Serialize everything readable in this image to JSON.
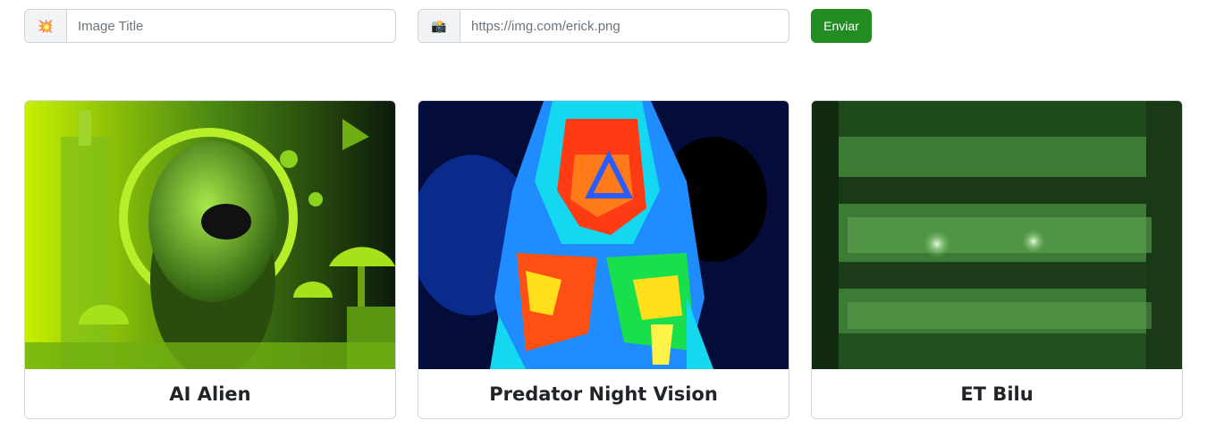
{
  "form": {
    "title_field": {
      "icon": "explosion-icon",
      "icon_glyph": "💥",
      "placeholder": "Image Title",
      "value": ""
    },
    "url_field": {
      "icon": "camera-icon",
      "icon_glyph": "📸",
      "placeholder": "https://img.com/erick.png",
      "value": ""
    },
    "submit_label": "Enviar",
    "submit_color": "#228b22"
  },
  "cards": [
    {
      "title": "AI Alien",
      "image": "green-alien-art"
    },
    {
      "title": "Predator Night Vision",
      "image": "thermal-predator"
    },
    {
      "title": "ET Bilu",
      "image": "green-night-vision-face"
    }
  ]
}
